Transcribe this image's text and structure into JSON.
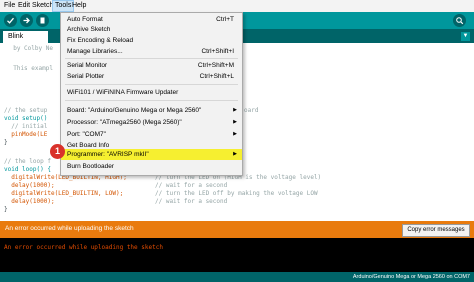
{
  "menubar": [
    "File",
    "Edit",
    "Sketch",
    "Tools",
    "Help"
  ],
  "tab": {
    "label": "Blink"
  },
  "code": {
    "lines": [
      "  by Colby Ne",
      "",
      "  This exampl",
      "",
      "",
      "",
      "// the setup",
      "void setup()",
      "  // initial",
      "  pinMode(LE",
      "}",
      "",
      "// the loop f",
      "void loop() {"
    ],
    "board_comment_fragment": "oard",
    "loop_lines": [
      {
        "code": "  digitalWrite(LED_BUILTIN, HIGH);",
        "comment": "// turn the LED on (HIGH is the voltage level)"
      },
      {
        "code": "  delay(1000);",
        "comment": "// wait for a second"
      },
      {
        "code": "  digitalWrite(LED_BUILTIN, LOW);",
        "comment": "// turn the LED off by making the voltage LOW"
      },
      {
        "code": "  delay(1000);",
        "comment": "// wait for a second"
      }
    ],
    "closing": "}"
  },
  "tools_menu": {
    "items": [
      {
        "label": "Auto Format",
        "shortcut": "Ctrl+T"
      },
      {
        "label": "Archive Sketch",
        "shortcut": ""
      },
      {
        "label": "Fix Encoding & Reload",
        "shortcut": ""
      },
      {
        "label": "Manage Libraries...",
        "shortcut": "Ctrl+Shift+I"
      },
      {
        "label": "Serial Monitor",
        "shortcut": "Ctrl+Shift+M"
      },
      {
        "label": "Serial Plotter",
        "shortcut": "Ctrl+Shift+L"
      },
      {
        "label": "WiFi101 / WiFiNINA Firmware Updater",
        "shortcut": ""
      },
      {
        "label": "Board: \"Arduino/Genuino Mega or Mega 2560\"",
        "submenu": true
      },
      {
        "label": "Processor: \"ATmega2560 (Mega 2560)\"",
        "submenu": true
      },
      {
        "label": "Port: \"COM7\"",
        "submenu": true
      },
      {
        "label": "Get Board Info",
        "shortcut": ""
      },
      {
        "label": "Programmer: \"AVRISP mkII\"",
        "submenu": true,
        "highlighted": true
      },
      {
        "label": "Burn Bootloader",
        "shortcut": ""
      }
    ]
  },
  "callout": "1",
  "error_bar": {
    "message": "An error occurred while uploading the sketch",
    "copy_button": "Copy error messages"
  },
  "console": {
    "message": "An error occurred while uploading the sketch"
  },
  "status": {
    "text": "Arduino/Genuino Mega or Mega 2560 on COM7"
  },
  "colors": {
    "teal": "#00979c",
    "dark_teal": "#006468",
    "error_orange": "#e97b0e",
    "highlight": "#f6ef30"
  }
}
